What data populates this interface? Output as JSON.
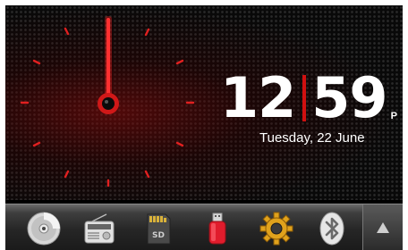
{
  "clock": {
    "hours": "12",
    "minutes": "59",
    "ampm": "P",
    "date": "Tuesday, 22 June",
    "accent_color": "#e01818"
  },
  "dock": {
    "items": [
      {
        "name": "cd-disc-icon"
      },
      {
        "name": "radio-icon"
      },
      {
        "name": "sd-card-icon"
      },
      {
        "name": "usb-drive-icon"
      },
      {
        "name": "settings-gear-icon"
      },
      {
        "name": "bluetooth-icon"
      }
    ],
    "expand_icon": "up-arrow-icon"
  }
}
